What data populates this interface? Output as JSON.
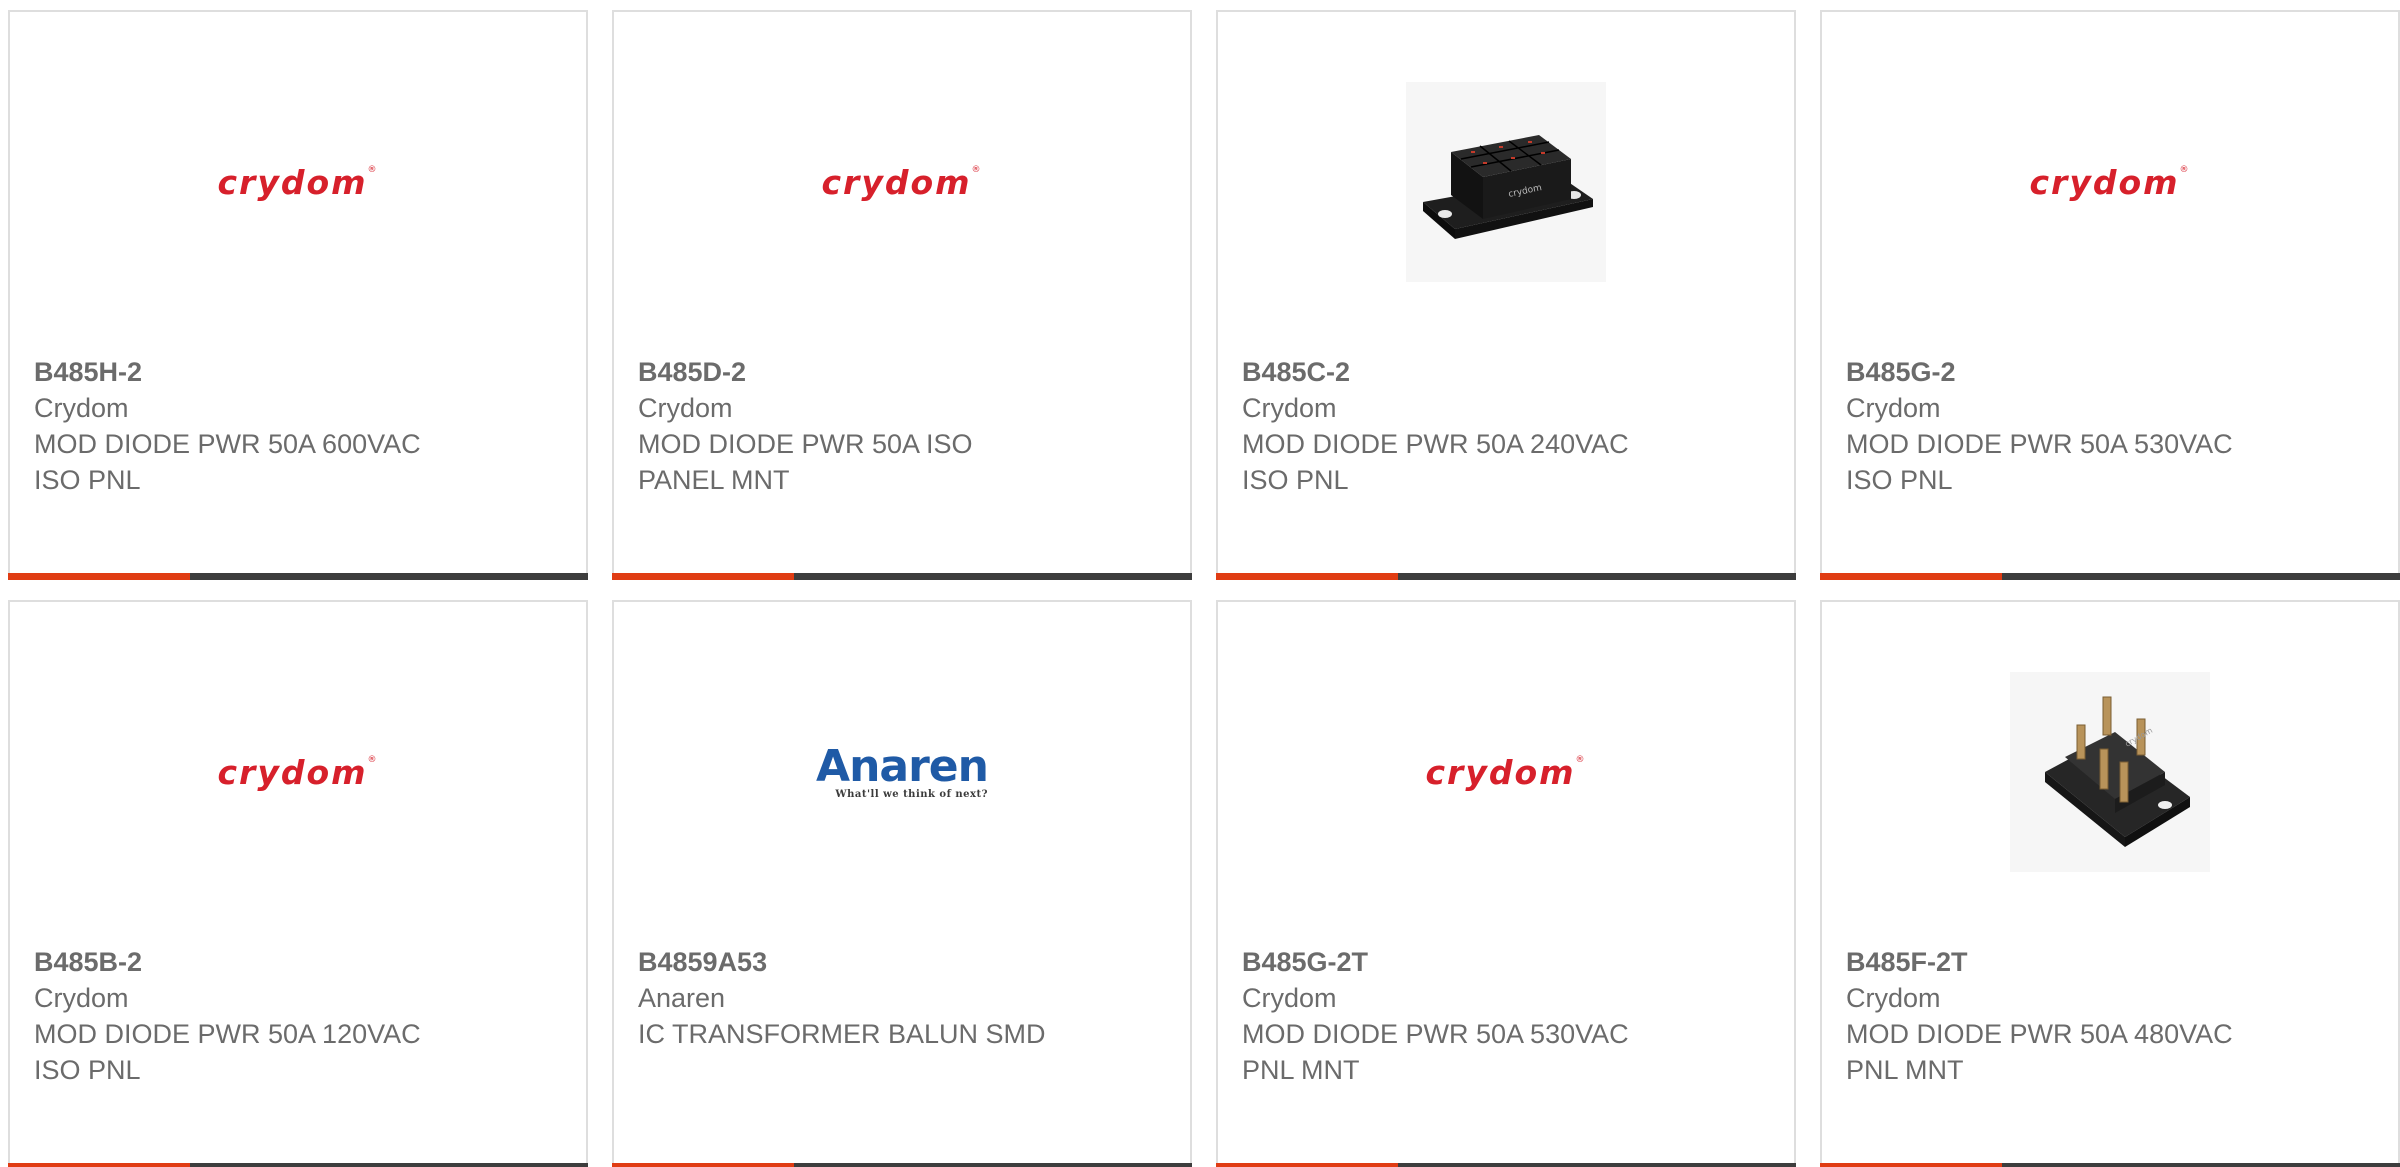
{
  "colors": {
    "accent_bar": "#e03c13",
    "dark_bar": "#3d3d3d",
    "text": "#6b6b6b",
    "crydom_red": "#d7202b",
    "anaren_blue": "#1f5aa6"
  },
  "products": [
    {
      "part_number": "B485H-2",
      "manufacturer": "Crydom",
      "description_line1": "MOD DIODE PWR 50A 600VAC",
      "description_line2": "ISO PNL",
      "image": "crydom-logo",
      "logo_text": "crydom"
    },
    {
      "part_number": "B485D-2",
      "manufacturer": "Crydom",
      "description_line1": "MOD DIODE PWR 50A ISO",
      "description_line2": "PANEL MNT",
      "image": "crydom-logo",
      "logo_text": "crydom"
    },
    {
      "part_number": "B485C-2",
      "manufacturer": "Crydom",
      "description_line1": "MOD DIODE PWR 50A 240VAC",
      "description_line2": "ISO PNL",
      "image": "diode-module-photo"
    },
    {
      "part_number": "B485G-2",
      "manufacturer": "Crydom",
      "description_line1": "MOD DIODE PWR 50A 530VAC",
      "description_line2": "ISO PNL",
      "image": "crydom-logo",
      "logo_text": "crydom"
    },
    {
      "part_number": "B485B-2",
      "manufacturer": "Crydom",
      "description_line1": "MOD DIODE PWR 50A 120VAC",
      "description_line2": "ISO PNL",
      "image": "crydom-logo",
      "logo_text": "crydom"
    },
    {
      "part_number": "B4859A53",
      "manufacturer": "Anaren",
      "description_line1": "IC TRANSFORMER BALUN SMD",
      "description_line2": "",
      "image": "anaren-logo",
      "logo_text": "Anaren",
      "logo_tagline": "What'll we think of next?"
    },
    {
      "part_number": "B485G-2T",
      "manufacturer": "Crydom",
      "description_line1": "MOD DIODE PWR 50A 530VAC",
      "description_line2": "PNL MNT",
      "image": "crydom-logo",
      "logo_text": "crydom"
    },
    {
      "part_number": "B485F-2T",
      "manufacturer": "Crydom",
      "description_line1": "MOD DIODE PWR 50A 480VAC",
      "description_line2": "PNL MNT",
      "image": "diode-module-tab-photo"
    }
  ]
}
